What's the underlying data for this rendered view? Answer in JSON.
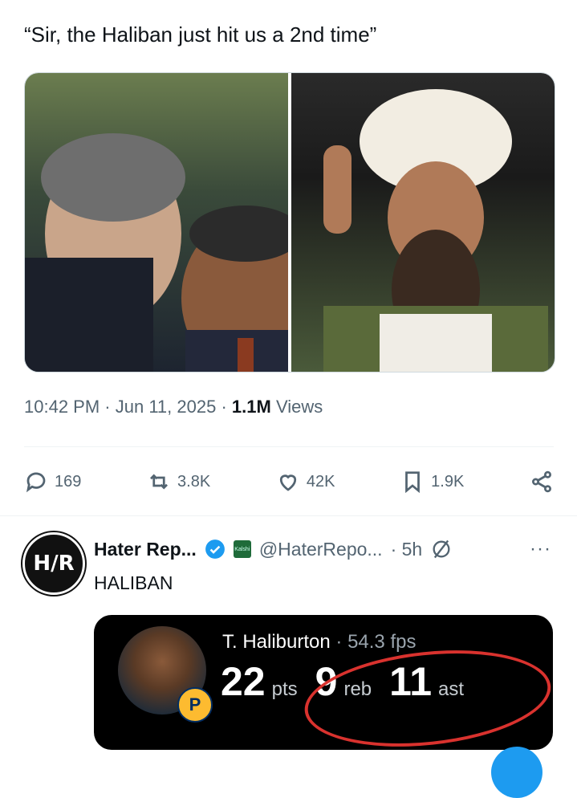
{
  "tweet": {
    "text": "“Sir, the Haliban just hit us a 2nd time”",
    "time": "10:42 PM",
    "date": "Jun 11, 2025",
    "views_count": "1.1M",
    "views_label": "Views"
  },
  "actions": {
    "replies": "169",
    "reposts": "3.8K",
    "likes": "42K",
    "bookmarks": "1.9K"
  },
  "reply": {
    "avatar_text": "H/R",
    "name": "Hater Rep...",
    "kalshi_badge": "Kalshi",
    "handle": "@HaterRepo...",
    "time": "· 5h",
    "text": "HALIBAN"
  },
  "stat_card": {
    "player": "T. Haliburton",
    "fps": "· 54.3 fps",
    "pts_value": "22",
    "pts_label": "pts",
    "reb_value": "9",
    "reb_label": "reb",
    "ast_value": "11",
    "ast_label": "ast",
    "team_logo_text": "P"
  },
  "colors": {
    "accent": "#1d9bf0",
    "secondary_text": "#536471",
    "annotation_red": "#d9322e"
  }
}
